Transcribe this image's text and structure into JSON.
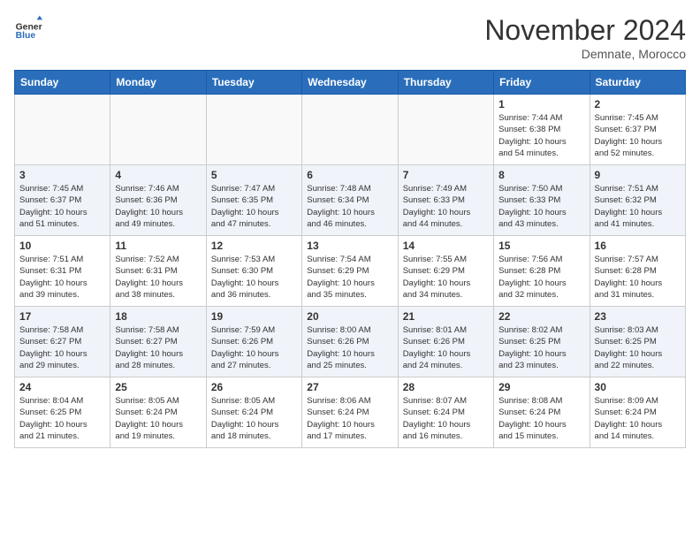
{
  "header": {
    "logo_general": "General",
    "logo_blue": "Blue",
    "month_title": "November 2024",
    "location": "Demnate, Morocco"
  },
  "weekdays": [
    "Sunday",
    "Monday",
    "Tuesday",
    "Wednesday",
    "Thursday",
    "Friday",
    "Saturday"
  ],
  "weeks": [
    [
      {
        "day": "",
        "info": ""
      },
      {
        "day": "",
        "info": ""
      },
      {
        "day": "",
        "info": ""
      },
      {
        "day": "",
        "info": ""
      },
      {
        "day": "",
        "info": ""
      },
      {
        "day": "1",
        "info": "Sunrise: 7:44 AM\nSunset: 6:38 PM\nDaylight: 10 hours\nand 54 minutes."
      },
      {
        "day": "2",
        "info": "Sunrise: 7:45 AM\nSunset: 6:37 PM\nDaylight: 10 hours\nand 52 minutes."
      }
    ],
    [
      {
        "day": "3",
        "info": "Sunrise: 7:45 AM\nSunset: 6:37 PM\nDaylight: 10 hours\nand 51 minutes."
      },
      {
        "day": "4",
        "info": "Sunrise: 7:46 AM\nSunset: 6:36 PM\nDaylight: 10 hours\nand 49 minutes."
      },
      {
        "day": "5",
        "info": "Sunrise: 7:47 AM\nSunset: 6:35 PM\nDaylight: 10 hours\nand 47 minutes."
      },
      {
        "day": "6",
        "info": "Sunrise: 7:48 AM\nSunset: 6:34 PM\nDaylight: 10 hours\nand 46 minutes."
      },
      {
        "day": "7",
        "info": "Sunrise: 7:49 AM\nSunset: 6:33 PM\nDaylight: 10 hours\nand 44 minutes."
      },
      {
        "day": "8",
        "info": "Sunrise: 7:50 AM\nSunset: 6:33 PM\nDaylight: 10 hours\nand 43 minutes."
      },
      {
        "day": "9",
        "info": "Sunrise: 7:51 AM\nSunset: 6:32 PM\nDaylight: 10 hours\nand 41 minutes."
      }
    ],
    [
      {
        "day": "10",
        "info": "Sunrise: 7:51 AM\nSunset: 6:31 PM\nDaylight: 10 hours\nand 39 minutes."
      },
      {
        "day": "11",
        "info": "Sunrise: 7:52 AM\nSunset: 6:31 PM\nDaylight: 10 hours\nand 38 minutes."
      },
      {
        "day": "12",
        "info": "Sunrise: 7:53 AM\nSunset: 6:30 PM\nDaylight: 10 hours\nand 36 minutes."
      },
      {
        "day": "13",
        "info": "Sunrise: 7:54 AM\nSunset: 6:29 PM\nDaylight: 10 hours\nand 35 minutes."
      },
      {
        "day": "14",
        "info": "Sunrise: 7:55 AM\nSunset: 6:29 PM\nDaylight: 10 hours\nand 34 minutes."
      },
      {
        "day": "15",
        "info": "Sunrise: 7:56 AM\nSunset: 6:28 PM\nDaylight: 10 hours\nand 32 minutes."
      },
      {
        "day": "16",
        "info": "Sunrise: 7:57 AM\nSunset: 6:28 PM\nDaylight: 10 hours\nand 31 minutes."
      }
    ],
    [
      {
        "day": "17",
        "info": "Sunrise: 7:58 AM\nSunset: 6:27 PM\nDaylight: 10 hours\nand 29 minutes."
      },
      {
        "day": "18",
        "info": "Sunrise: 7:58 AM\nSunset: 6:27 PM\nDaylight: 10 hours\nand 28 minutes."
      },
      {
        "day": "19",
        "info": "Sunrise: 7:59 AM\nSunset: 6:26 PM\nDaylight: 10 hours\nand 27 minutes."
      },
      {
        "day": "20",
        "info": "Sunrise: 8:00 AM\nSunset: 6:26 PM\nDaylight: 10 hours\nand 25 minutes."
      },
      {
        "day": "21",
        "info": "Sunrise: 8:01 AM\nSunset: 6:26 PM\nDaylight: 10 hours\nand 24 minutes."
      },
      {
        "day": "22",
        "info": "Sunrise: 8:02 AM\nSunset: 6:25 PM\nDaylight: 10 hours\nand 23 minutes."
      },
      {
        "day": "23",
        "info": "Sunrise: 8:03 AM\nSunset: 6:25 PM\nDaylight: 10 hours\nand 22 minutes."
      }
    ],
    [
      {
        "day": "24",
        "info": "Sunrise: 8:04 AM\nSunset: 6:25 PM\nDaylight: 10 hours\nand 21 minutes."
      },
      {
        "day": "25",
        "info": "Sunrise: 8:05 AM\nSunset: 6:24 PM\nDaylight: 10 hours\nand 19 minutes."
      },
      {
        "day": "26",
        "info": "Sunrise: 8:05 AM\nSunset: 6:24 PM\nDaylight: 10 hours\nand 18 minutes."
      },
      {
        "day": "27",
        "info": "Sunrise: 8:06 AM\nSunset: 6:24 PM\nDaylight: 10 hours\nand 17 minutes."
      },
      {
        "day": "28",
        "info": "Sunrise: 8:07 AM\nSunset: 6:24 PM\nDaylight: 10 hours\nand 16 minutes."
      },
      {
        "day": "29",
        "info": "Sunrise: 8:08 AM\nSunset: 6:24 PM\nDaylight: 10 hours\nand 15 minutes."
      },
      {
        "day": "30",
        "info": "Sunrise: 8:09 AM\nSunset: 6:24 PM\nDaylight: 10 hours\nand 14 minutes."
      }
    ]
  ]
}
